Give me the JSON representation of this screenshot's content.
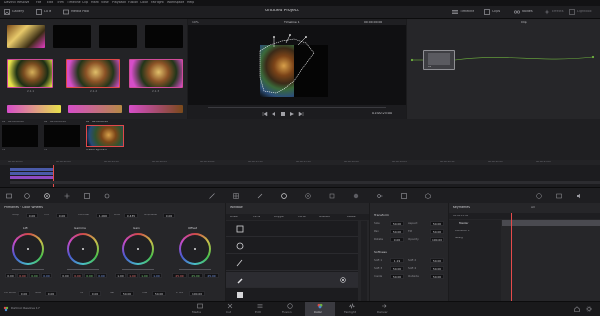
{
  "menubar": {
    "items": [
      "DaVinci Resolve",
      "File",
      "Edit",
      "Trim",
      "Timeline",
      "Clip",
      "Mark",
      "View",
      "Playback",
      "Fusion",
      "Color",
      "Fairlight",
      "Workspace",
      "Help"
    ]
  },
  "toolbar": {
    "left_items": [
      "Gallery",
      "LUTs",
      "Media Pool"
    ],
    "project_title": "Untitled Project",
    "right_items": [
      "Timeline",
      "Clips",
      "Nodes",
      "Effects",
      "Lightbox"
    ],
    "zoom": "10%",
    "timeline_name": "Timeline 1",
    "timecode_top": "00:00:00:00",
    "clip_mode": "Clip"
  },
  "viewer": {
    "timecode": "01:00:25:00"
  },
  "clips": [
    {
      "id": "01",
      "timecode": "00:00:00:00",
      "label": "V1"
    },
    {
      "id": "02",
      "timecode": "00:00:04:29",
      "label": "V1"
    },
    {
      "id": "03",
      "timecode": "00:00:09:29",
      "label": "V1"
    },
    {
      "clip_name": "H.264 High L4.2"
    }
  ],
  "gallery": {
    "stills": [
      "2.1.1",
      "2.1.2",
      "2.1.3"
    ],
    "header": "Still Album"
  },
  "node": {
    "label": "01"
  },
  "timeline_ruler": [
    "00:00:00:00",
    "00:00:02:08",
    "00:00:04:16",
    "00:00:06:24",
    "00:00:09:02",
    "00:00:11:10",
    "00:00:13:18",
    "00:00:16:26",
    "00:00:18:04",
    "00:00:20:12",
    "00:00:22:20",
    "00:00:25:08"
  ],
  "color_wheels": {
    "title": "Primaries · Color Wheels",
    "params": {
      "contrast_label": "Contrast",
      "contrast_val": "1.000",
      "pivot_label": "Pivot",
      "pivot_val": "0.435",
      "mid_detail_label": "Mid/Detail",
      "mid_detail_val": "0.00",
      "temp_label": "Temp",
      "temp_val": "0.00",
      "tint_label": "Tint",
      "tint_val": "0.00"
    },
    "wheels": [
      {
        "name": "Lift",
        "values": [
          "0.00",
          "0.00",
          "0.00",
          "0.00"
        ]
      },
      {
        "name": "Gamma",
        "values": [
          "0.00",
          "0.00",
          "0.00",
          "0.00"
        ]
      },
      {
        "name": "Gain",
        "values": [
          "1.00",
          "1.00",
          "1.00",
          "1.00"
        ]
      },
      {
        "name": "Offset",
        "values": [
          "25.00",
          "25.00",
          "25.00"
        ]
      }
    ],
    "footer": {
      "color_boost_label": "Col Boost",
      "color_boost": "0.00",
      "shadows_label": "Shad",
      "shadows": "0.00",
      "hl_label": "HL",
      "hl": "0.00",
      "sat_label": "Sat",
      "sat": "50.00",
      "hue_label": "Hue",
      "hue": "50.00",
      "lm_label": "L. Mix",
      "lm": "100.00"
    }
  },
  "window": {
    "title": "Window",
    "tools": [
      "Linear",
      "Circle",
      "Polygon",
      "Curve",
      "Gradient",
      "Delete"
    ],
    "shapes": [
      "Square",
      "Circle",
      "Pen",
      "Gradient"
    ]
  },
  "transform": {
    "title": "Transform",
    "fields": [
      {
        "label": "Size",
        "value": "50.00",
        "label2": "Aspect",
        "value2": "50.00"
      },
      {
        "label": "Pan",
        "value": "50.00",
        "label2": "Tilt",
        "value2": "50.00"
      },
      {
        "label": "Rotate",
        "value": "0.00",
        "label2": "Opacity",
        "value2": "100.00"
      }
    ],
    "softness_title": "Softness",
    "softness": [
      {
        "label": "Soft 1",
        "value": "1.19",
        "label2": "Soft 2",
        "value2": "50.00"
      },
      {
        "label": "Soft 3",
        "value": "50.00",
        "label2": "Soft 4",
        "value2": "50.00"
      },
      {
        "label": "Inside",
        "value": "50.00",
        "label2": "Outside",
        "value2": "50.00"
      }
    ]
  },
  "keyframes": {
    "title": "Keyframes",
    "filter": "All",
    "timecode": "00:00:25:00",
    "tracks": [
      "Master",
      "Corrector 1",
      "Sizing"
    ]
  },
  "pages": {
    "items": [
      "Media",
      "Cut",
      "Edit",
      "Fusion",
      "Color",
      "Fairlight",
      "Deliver"
    ],
    "active": "Color",
    "app_name": "DaVinci Resolve 17"
  },
  "colors": {
    "accent": "#e0484a",
    "active_tab": "#3a3a40",
    "playhead": "#e64b4b"
  }
}
